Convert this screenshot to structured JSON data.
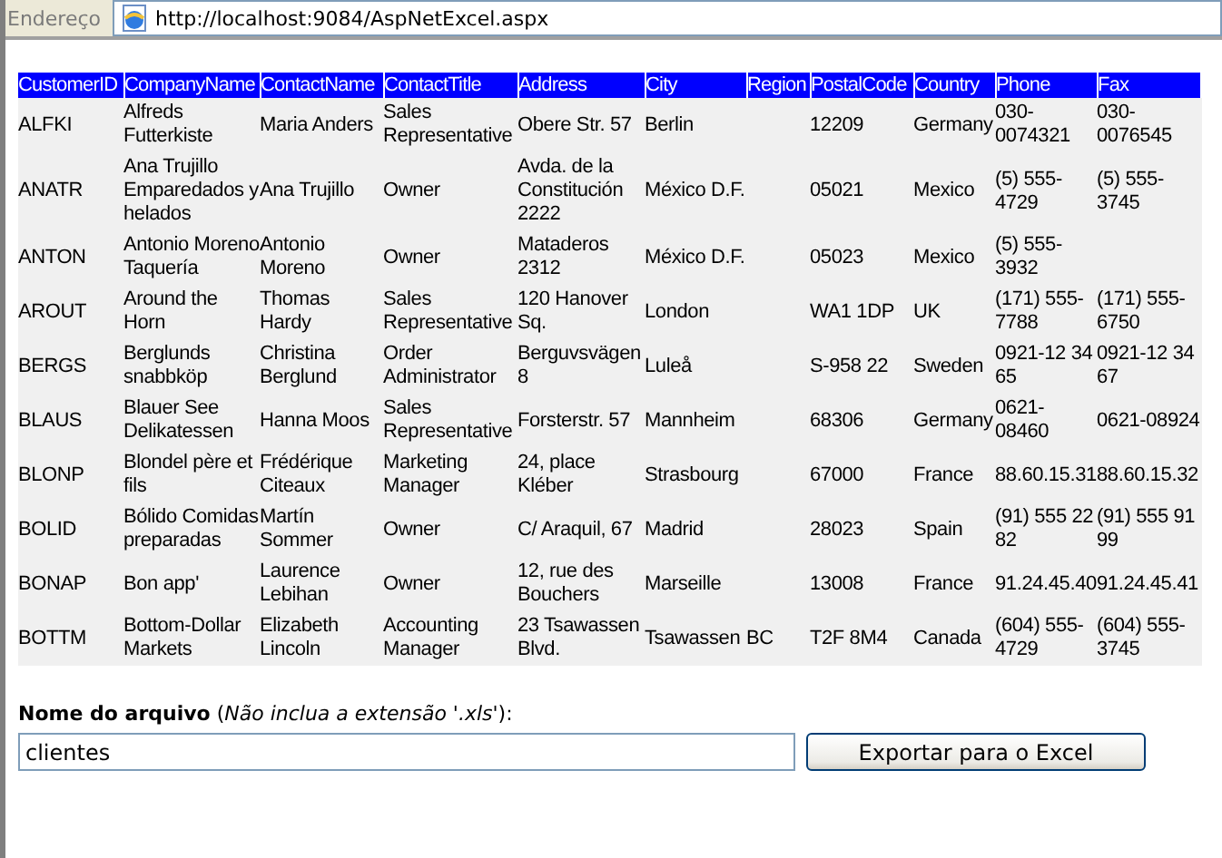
{
  "address_bar": {
    "label": "Endereço",
    "url": "http://localhost:9084/AspNetExcel.aspx"
  },
  "table": {
    "columns": [
      "CustomerID",
      "CompanyName",
      "ContactName",
      "ContactTitle",
      "Address",
      "City",
      "Region",
      "PostalCode",
      "Country",
      "Phone",
      "Fax"
    ],
    "rows": [
      [
        "ALFKI",
        "Alfreds Futterkiste",
        "Maria Anders",
        "Sales Representative",
        "Obere Str. 57",
        "Berlin",
        "",
        "12209",
        "Germany",
        "030-0074321",
        "030-0076545"
      ],
      [
        "ANATR",
        "Ana Trujillo Emparedados y helados",
        "Ana Trujillo",
        "Owner",
        "Avda. de la Constitución 2222",
        "México D.F.",
        "",
        "05021",
        "Mexico",
        "(5) 555-4729",
        "(5) 555-3745"
      ],
      [
        "ANTON",
        "Antonio Moreno Taquería",
        "Antonio Moreno",
        "Owner",
        "Mataderos 2312",
        "México D.F.",
        "",
        "05023",
        "Mexico",
        "(5) 555-3932",
        ""
      ],
      [
        "AROUT",
        "Around the Horn",
        "Thomas Hardy",
        "Sales Representative",
        "120 Hanover Sq.",
        "London",
        "",
        "WA1 1DP",
        "UK",
        "(171) 555-7788",
        "(171) 555-6750"
      ],
      [
        "BERGS",
        "Berglunds snabbköp",
        "Christina Berglund",
        "Order Administrator",
        "Berguvsvägen 8",
        "Luleå",
        "",
        "S-958 22",
        "Sweden",
        "0921-12 34 65",
        "0921-12 34 67"
      ],
      [
        "BLAUS",
        "Blauer See Delikatessen",
        "Hanna Moos",
        "Sales Representative",
        "Forsterstr. 57",
        "Mannheim",
        "",
        "68306",
        "Germany",
        "0621-08460",
        "0621-08924"
      ],
      [
        "BLONP",
        "Blondel père et fils",
        "Frédérique Citeaux",
        "Marketing Manager",
        "24, place Kléber",
        "Strasbourg",
        "",
        "67000",
        "France",
        "88.60.15.31",
        "88.60.15.32"
      ],
      [
        "BOLID",
        "Bólido Comidas preparadas",
        "Martín Sommer",
        "Owner",
        "C/ Araquil, 67",
        "Madrid",
        "",
        "28023",
        "Spain",
        "(91) 555 22 82",
        "(91) 555 91 99"
      ],
      [
        "BONAP",
        "Bon app'",
        "Laurence Lebihan",
        "Owner",
        "12, rue des Bouchers",
        "Marseille",
        "",
        "13008",
        "France",
        "91.24.45.40",
        "91.24.45.41"
      ],
      [
        "BOTTM",
        "Bottom-Dollar Markets",
        "Elizabeth Lincoln",
        "Accounting Manager",
        "23 Tsawassen Blvd.",
        "Tsawassen",
        "BC",
        "T2F 8M4",
        "Canada",
        "(604) 555-4729",
        "(604) 555-3745"
      ]
    ]
  },
  "export_form": {
    "label": "**Nome do arquivo** (*Não inclua a extensão '.xls'*):",
    "file_name": "clientes",
    "button": "Exportar para o Excel"
  }
}
